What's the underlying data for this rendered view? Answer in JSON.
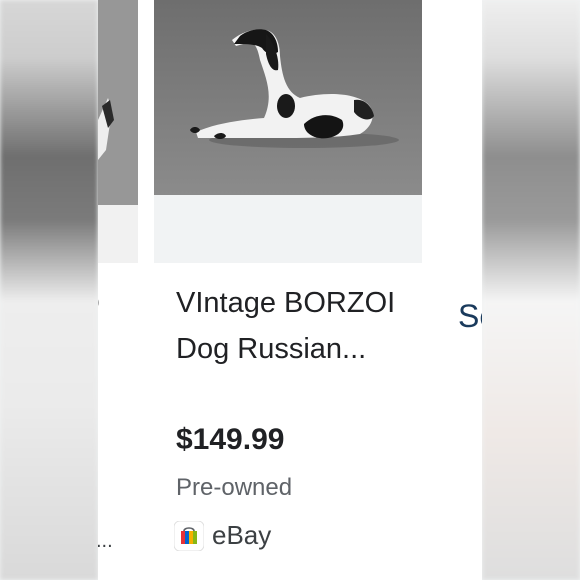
{
  "listing": {
    "title": "VIntage BORZOI Dog Russian...",
    "price": "$149.99",
    "condition": "Pre-owned",
    "seller": "eBay",
    "image_icon": "borzoi-figurine-image"
  },
  "left_card": {
    "title_fragment": "o",
    "seller_fragment": "..."
  },
  "right_fragment": {
    "text": "Se"
  },
  "colors": {
    "title": "#202124",
    "condition": "#5f6368",
    "right_link": "#1a3a5c"
  }
}
